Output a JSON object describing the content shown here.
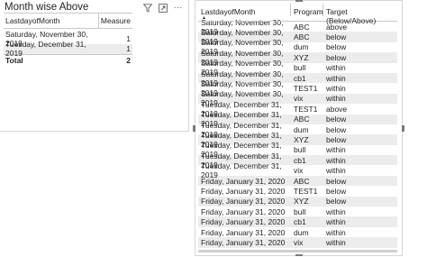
{
  "left_visual": {
    "title": "Month wise Above",
    "icons": [
      "filter-icon",
      "focus-mode-icon",
      "more-options-icon"
    ],
    "more_glyph": "···",
    "columns": [
      "LastdayofMonth",
      "Measure"
    ],
    "rows": [
      {
        "date": "Saturday, November 30, 2019",
        "measure": "1"
      },
      {
        "date": "Tuesday, December 31, 2019",
        "measure": "1"
      }
    ],
    "total": {
      "label": "Total",
      "value": "2"
    }
  },
  "right_visual": {
    "columns": [
      "LastdayofMonth",
      "Program",
      "Target (Below/Above)"
    ],
    "rows": [
      [
        "Saturday, November 30, 2019",
        "ABC",
        "above"
      ],
      [
        "Saturday, November 30, 2019",
        "ABC",
        "below"
      ],
      [
        "Saturday, November 30, 2019",
        "dum",
        "below"
      ],
      [
        "Saturday, November 30, 2019",
        "XYZ",
        "below"
      ],
      [
        "Saturday, November 30, 2019",
        "bull",
        "within"
      ],
      [
        "Saturday, November 30, 2019",
        "cb1",
        "within"
      ],
      [
        "Saturday, November 30, 2019",
        "TEST1",
        "within"
      ],
      [
        "Saturday, November 30, 2019",
        "vix",
        "within"
      ],
      [
        "Tuesday, December 31, 2019",
        "TEST1",
        "above"
      ],
      [
        "Tuesday, December 31, 2019",
        "ABC",
        "below"
      ],
      [
        "Tuesday, December 31, 2019",
        "dum",
        "below"
      ],
      [
        "Tuesday, December 31, 2019",
        "XYZ",
        "below"
      ],
      [
        "Tuesday, December 31, 2019",
        "bull",
        "within"
      ],
      [
        "Tuesday, December 31, 2019",
        "cb1",
        "within"
      ],
      [
        "Tuesday, December 31, 2019",
        "vix",
        "within"
      ],
      [
        "Friday, January 31, 2020",
        "ABC",
        "below"
      ],
      [
        "Friday, January 31, 2020",
        "TEST1",
        "below"
      ],
      [
        "Friday, January 31, 2020",
        "XYZ",
        "below"
      ],
      [
        "Friday, January 31, 2020",
        "bull",
        "within"
      ],
      [
        "Friday, January 31, 2020",
        "cb1",
        "within"
      ],
      [
        "Friday, January 31, 2020",
        "dum",
        "within"
      ],
      [
        "Friday, January 31, 2020",
        "vix",
        "within"
      ]
    ]
  },
  "colors": {
    "alt_row": "#ececec",
    "border": "#c8c8c8",
    "text": "#252423"
  }
}
